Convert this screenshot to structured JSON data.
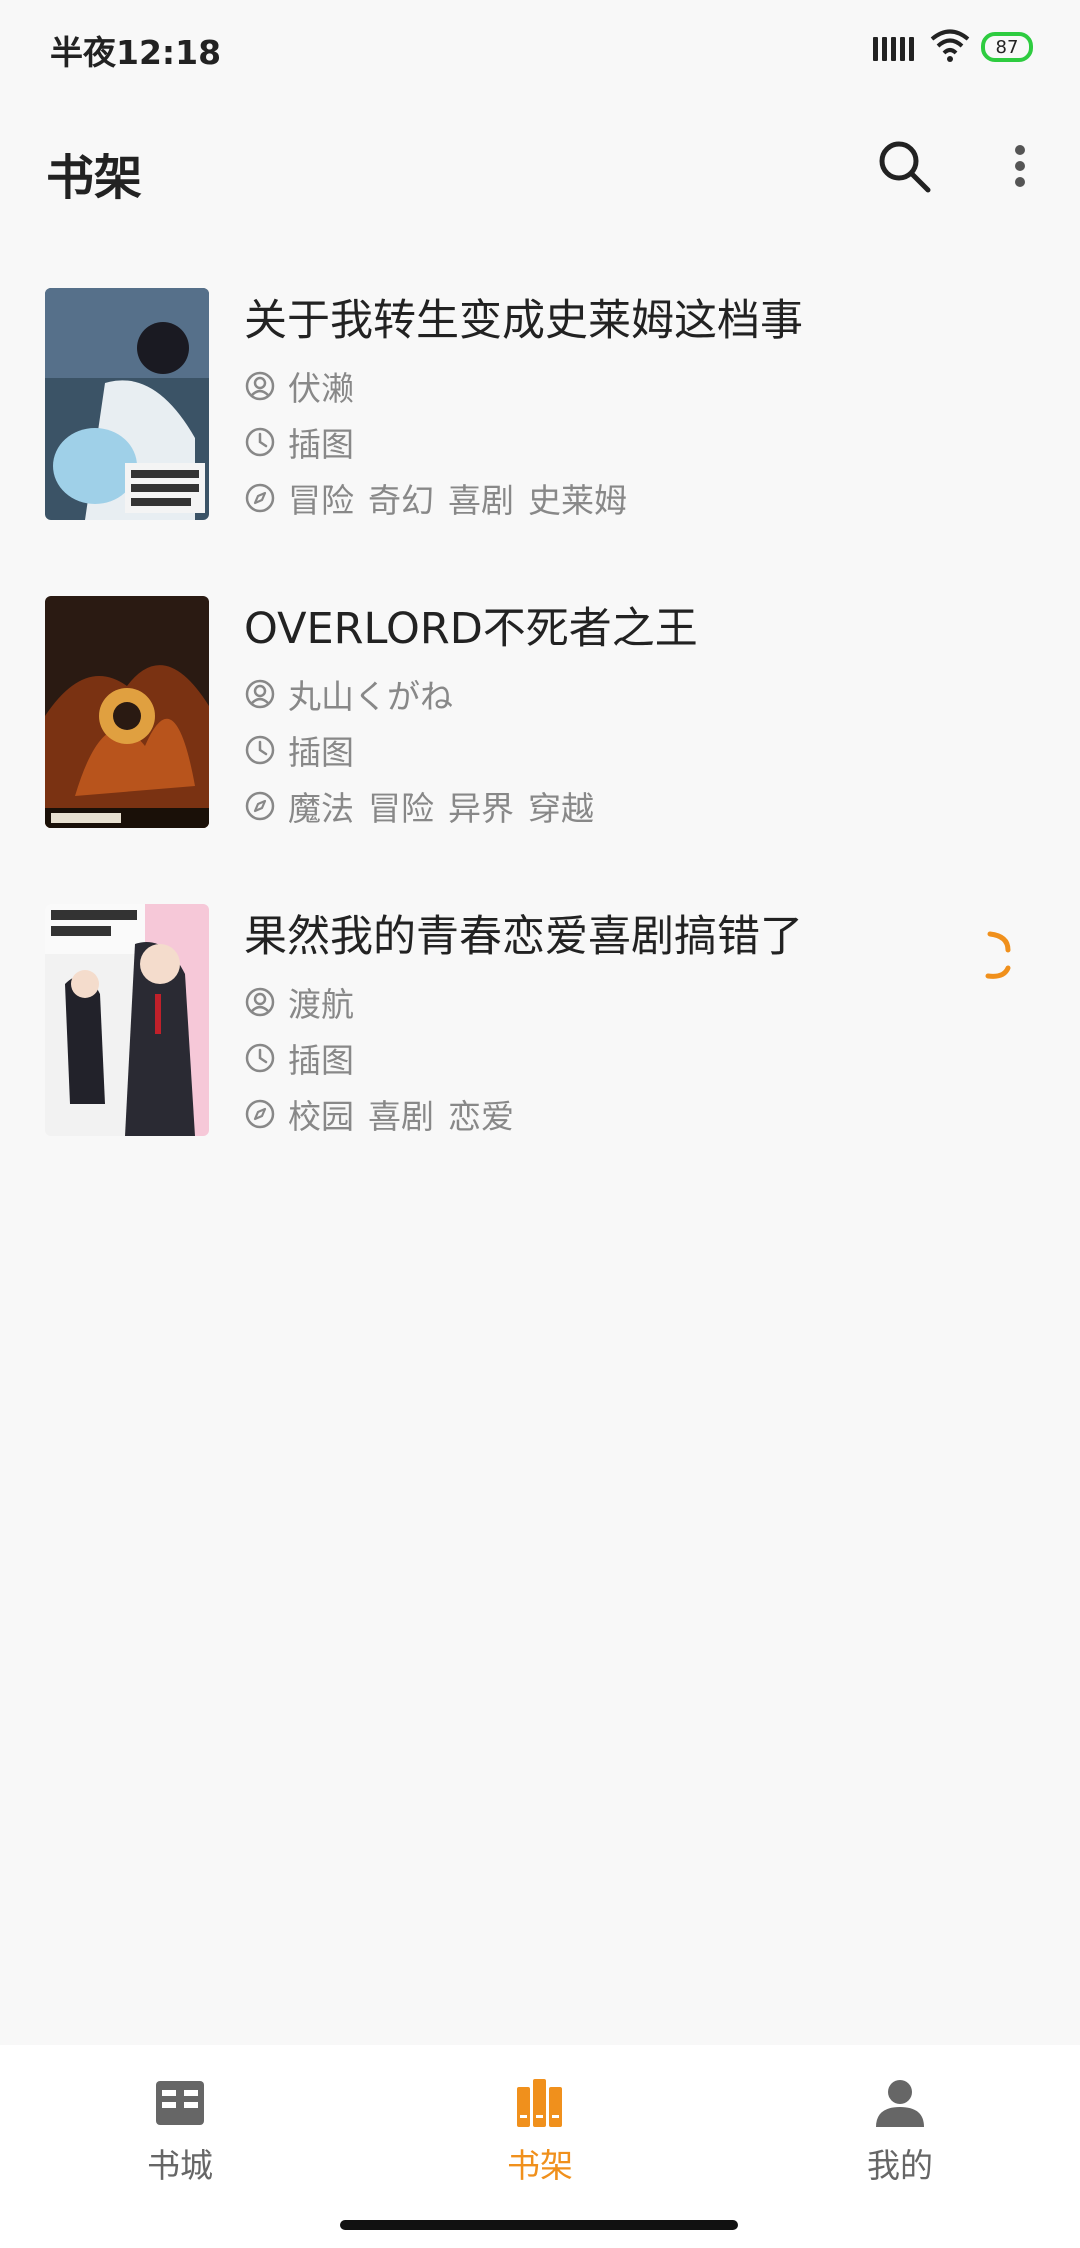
{
  "status_bar": {
    "time": "半夜12:18",
    "battery": "87"
  },
  "app_bar": {
    "title": "书架",
    "search_icon": "search-icon",
    "more_icon": "more-vert-icon"
  },
  "books": [
    {
      "title": "关于我转生变成史莱姆这档事",
      "author": "伏濑",
      "status": "插图",
      "tags": [
        "冒险",
        "奇幻",
        "喜剧",
        "史莱姆"
      ],
      "cover_colors": [
        "#3b5366",
        "#9fb4c2",
        "#e8eef2"
      ]
    },
    {
      "title": "OVERLORD不死者之王",
      "author": "丸山くがね",
      "status": "插图",
      "tags": [
        "魔法",
        "冒险",
        "异界",
        "穿越"
      ],
      "cover_colors": [
        "#2a1a12",
        "#b8541c",
        "#e0a040"
      ]
    },
    {
      "title": "果然我的青春恋爱喜剧搞错了",
      "author": "渡航",
      "status": "插图",
      "tags": [
        "校园",
        "喜剧",
        "恋爱"
      ],
      "cover_colors": [
        "#f2f2f2",
        "#e07aa0",
        "#2a2a33"
      ]
    }
  ],
  "loading_icon": "loading-spinner-icon",
  "bottom_nav": {
    "items": [
      {
        "label": "书城",
        "icon": "book-open-icon",
        "active": false
      },
      {
        "label": "书架",
        "icon": "bookshelf-icon",
        "active": true
      },
      {
        "label": "我的",
        "icon": "person-icon",
        "active": false
      }
    ]
  },
  "colors": {
    "accent": "#f0901c",
    "background": "#f8f8f8",
    "text": "#222222",
    "meta": "#888888",
    "battery": "#2ecc40"
  }
}
